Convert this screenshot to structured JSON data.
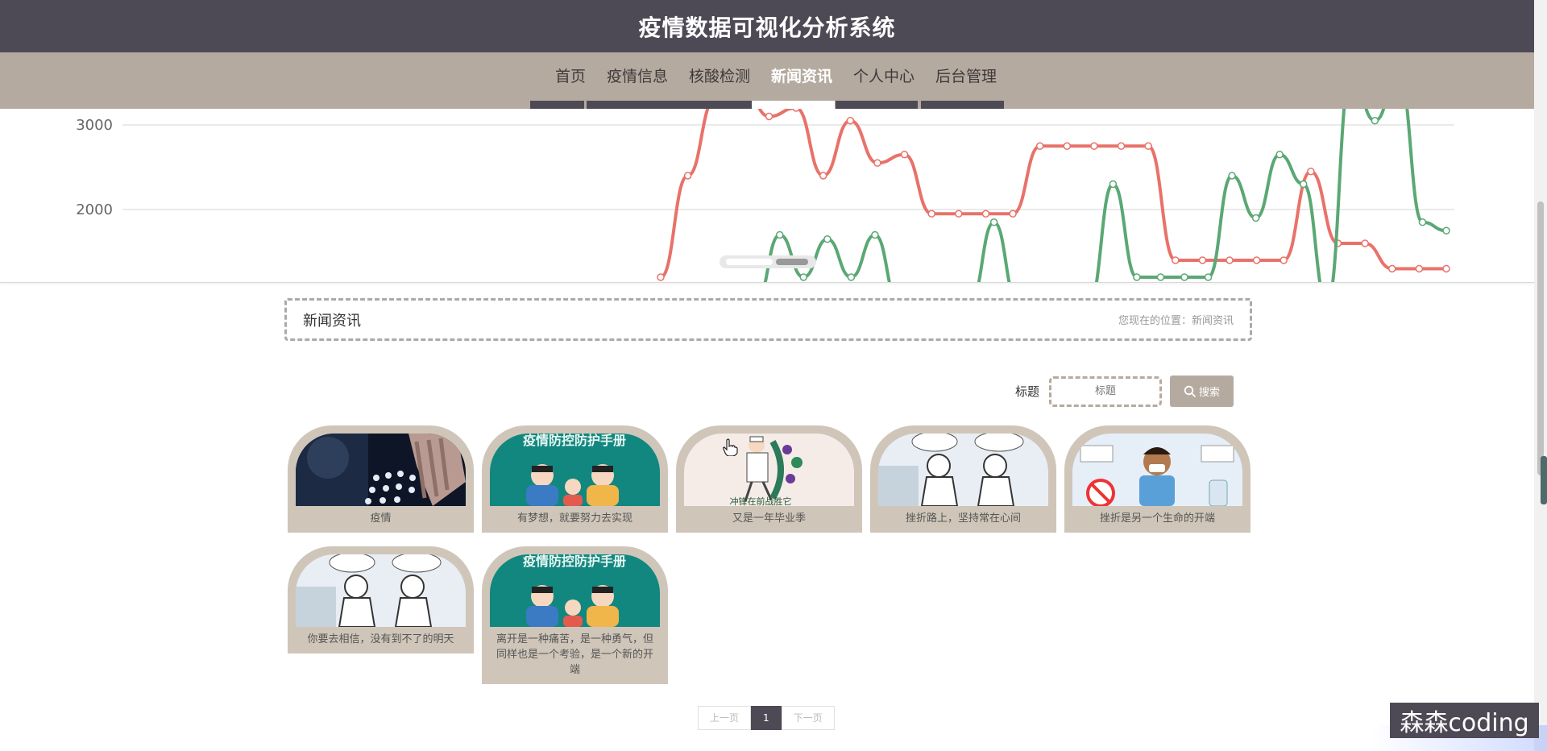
{
  "header": {
    "title": "疫情数据可视化分析系统"
  },
  "nav": {
    "items": [
      {
        "label": "首页",
        "active": false
      },
      {
        "label": "疫情信息",
        "active": false
      },
      {
        "label": "核酸检测",
        "active": false
      },
      {
        "label": "新闻资讯",
        "active": true
      },
      {
        "label": "个人中心",
        "active": false
      },
      {
        "label": "后台管理",
        "active": false
      }
    ]
  },
  "chart_data": {
    "type": "line",
    "yticks": [
      "3000",
      "2000"
    ],
    "series": [
      {
        "color": "#e8726a",
        "values": [
          1200,
          2400,
          3300,
          3500,
          3100,
          3200,
          2400,
          3050,
          2550,
          2650,
          1950,
          1950,
          1950,
          1950,
          2750,
          2750,
          2750,
          2750,
          2750,
          1400,
          1400,
          1400,
          1400,
          1400,
          2450,
          1600,
          1600,
          1300,
          1300,
          1300
        ]
      },
      {
        "color": "#5aa874",
        "values": [
          900,
          900,
          900,
          900,
          900,
          1700,
          1200,
          1650,
          1200,
          1700,
          900,
          900,
          900,
          900,
          1850,
          900,
          900,
          900,
          900,
          2300,
          1200,
          1200,
          1200,
          1200,
          2400,
          1900,
          2650,
          2300,
          900,
          3600,
          3050,
          3600,
          1850,
          1750
        ]
      }
    ]
  },
  "breadcrumb": {
    "title": "新闻资讯",
    "position": "您现在的位置：新闻资讯"
  },
  "search": {
    "label": "标题",
    "placeholder": "标题",
    "button": "搜索"
  },
  "news": [
    {
      "caption": "疫情",
      "image": "dark-tech-hand"
    },
    {
      "caption": "有梦想，就要努力去实现",
      "image": "family-poster"
    },
    {
      "caption": "又是一年毕业季",
      "image": "doctor-virus"
    },
    {
      "caption": "挫折路上，坚持常在心间",
      "image": "comic-masks"
    },
    {
      "caption": "挫折是另一个生命的开端",
      "image": "man-mask"
    },
    {
      "caption": "你要去相信，没有到不了的明天",
      "image": "comic-masks"
    },
    {
      "caption": "离开是一种痛苦，是一种勇气，但同样也是一个考验，是一个新的开端",
      "image": "family-poster"
    }
  ],
  "poster_text": {
    "family": "疫情防控防护手册",
    "doctor": "冲锋在前战胜它"
  },
  "pagination": {
    "prev": "上一页",
    "current": "1",
    "next": "下一页"
  },
  "watermark": "森森coding",
  "colors": {
    "header": "#4e4a55",
    "nav": "#b5aaa0",
    "card": "#cfc6b9"
  }
}
